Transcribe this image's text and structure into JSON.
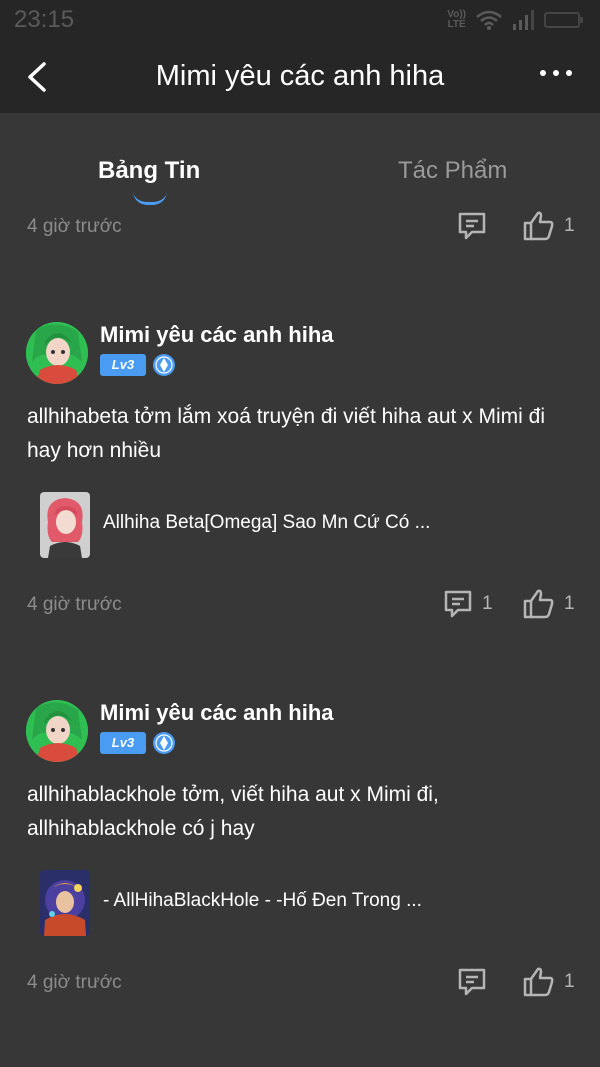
{
  "status_bar": {
    "time": "23:15",
    "network": "Vo)) LTE"
  },
  "header": {
    "title": "Mimi yêu các anh hiha"
  },
  "tabs": [
    {
      "label": "Bảng Tin",
      "active": true
    },
    {
      "label": "Tác Phẩm",
      "active": false
    }
  ],
  "colors": {
    "accent": "#4a9cf2",
    "background": "#373737",
    "header": "#262626"
  },
  "top_footer": {
    "time": "4 giờ trước",
    "comments": "",
    "likes": "1"
  },
  "posts": [
    {
      "author": "Mimi yêu các anh hiha",
      "level": "Lv3",
      "text": "allhihabeta tởm lắm xoá truyện đi viết hiha aut x Mimi đi hay hơn nhiều",
      "story_title": "Allhiha Beta[Omega] Sao Mn Cứ Có ...",
      "time": "4 giờ trước",
      "comments": "1",
      "likes": "1"
    },
    {
      "author": "Mimi yêu các anh hiha",
      "level": "Lv3",
      "text": "allhihablackhole tởm, viết hiha aut x Mimi đi, allhihablackhole có j hay",
      "story_title": "- AllHihaBlackHole - -Hố Đen Trong ...",
      "time": "4 giờ trước",
      "comments": "",
      "likes": "1"
    }
  ]
}
